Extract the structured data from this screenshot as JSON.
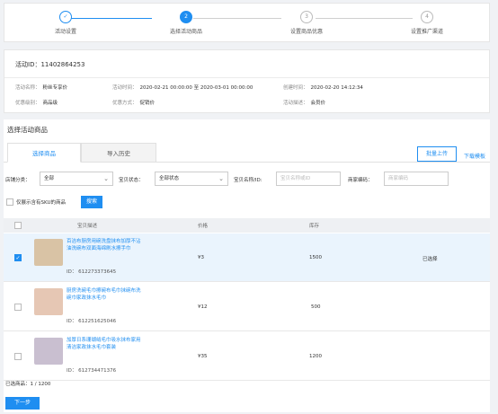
{
  "steps": [
    {
      "num": "✓",
      "label": "活动设置",
      "state": "done"
    },
    {
      "num": "2",
      "label": "选择活动商品",
      "state": "active"
    },
    {
      "num": "3",
      "label": "设置商品优惠",
      "state": "todo"
    },
    {
      "num": "4",
      "label": "设置推广渠道",
      "state": "todo"
    }
  ],
  "activity": {
    "id_label": "活动ID：",
    "id": "11402864253",
    "name_key": "活动名称：",
    "name": "粉丝专享价",
    "time_key": "活动时间：",
    "time": "2020-02-21 00:00:00 至 2020-03-01 00:00:00",
    "created_key": "创建时间：",
    "created": "2020-02-20 14:12:34",
    "level_key": "优惠级别：",
    "level": "商品级",
    "mode_key": "优惠方式：",
    "mode": "促销价",
    "desc_key": "活动描述：",
    "desc": "会员价"
  },
  "section_title": "选择活动商品",
  "tabs": {
    "select": "选择商品",
    "history": "导入历史"
  },
  "actions": {
    "bulk_upload": "批量上传",
    "download_template": "下载模板"
  },
  "filters": {
    "shop_category_label": "店铺分类：",
    "shop_category_value": "全部",
    "status_label": "宝贝状态：",
    "status_value": "全部状态",
    "name_label": "宝贝名称/ID:",
    "name_placeholder": "宝贝名称或ID",
    "code_label": "商家编码：",
    "code_placeholder": "商家编码",
    "sku_only_label": "仅展示含有SKU的商品",
    "search_button": "搜索"
  },
  "table": {
    "headers": {
      "desc": "宝贝描述",
      "price": "价格",
      "stock": "库存"
    },
    "rows": [
      {
        "name": "百洁布厨房用碗洗盘抹布加厚不沾油洗碗布双面海绵刷水擦手巾",
        "id": "ID： 612273373645",
        "price": "¥3",
        "stock": "1500",
        "status": "已选择",
        "checked": true,
        "thumb_color": "#d9c3a5"
      },
      {
        "name": "厨房洗碗毛巾擦碗布毛巾抹碗布洗碗巾家政抹水毛巾",
        "id": "ID： 612251625046",
        "price": "¥12",
        "stock": "500",
        "status": "",
        "checked": false,
        "thumb_color": "#e6c7b4"
      },
      {
        "name": "加厚日系珊瑚绒毛巾吸水抹布家用清洁家政抹水毛巾套装",
        "id": "ID： 612734471376",
        "price": "¥35",
        "stock": "1200",
        "status": "",
        "checked": false,
        "thumb_color": "#c9bfd0"
      }
    ]
  },
  "selection_count": "已选商品：1 / 1200",
  "next_button": "下一步",
  "colors": {
    "accent": "#1f8ef1",
    "selected_row": "#eaf4fd"
  }
}
